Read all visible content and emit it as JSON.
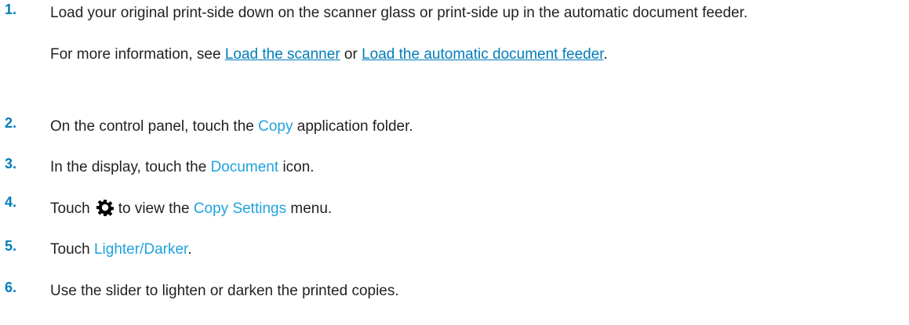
{
  "steps": [
    {
      "number": "1.",
      "text": "Load your original print-side down on the scanner glass or print-side up in the automatic document feeder.",
      "info_prefix": "For more information, see ",
      "link1": "Load the scanner",
      "info_mid": " or ",
      "link2": "Load the automatic document feeder",
      "info_suffix": "."
    },
    {
      "number": "2.",
      "pre": "On the control panel, touch the ",
      "kw": "Copy",
      "post": " application folder."
    },
    {
      "number": "3.",
      "pre": "In the display, touch the ",
      "kw": "Document",
      "post": " icon."
    },
    {
      "number": "4.",
      "pre": "Touch",
      "icon": "gear-icon",
      "mid": "to view the ",
      "kw": "Copy Settings",
      "post": " menu."
    },
    {
      "number": "5.",
      "pre": "Touch ",
      "kw": "Lighter/Darker",
      "post": "."
    },
    {
      "number": "6.",
      "text": "Use the slider to lighten or darken the printed copies."
    }
  ],
  "colors": {
    "number": "#007dba",
    "keyword": "#1fa3dd",
    "link": "#007dba",
    "text": "#231f20"
  }
}
